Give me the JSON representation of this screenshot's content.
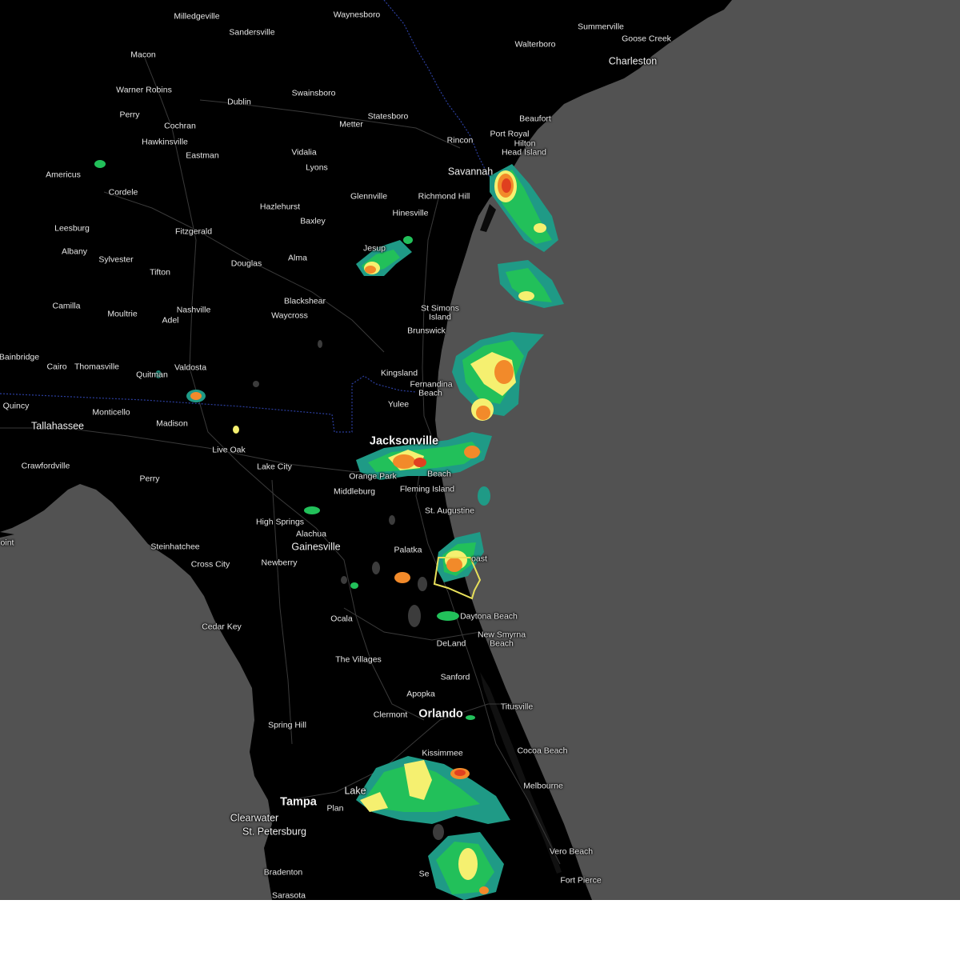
{
  "map": {
    "background_color": "#525252",
    "land_color": "#000000",
    "alert_polygon_color": "#e8e05a",
    "radar_colors": [
      "#1f9a86",
      "#22c05a",
      "#f5f070",
      "#f28a2a",
      "#e0401f"
    ]
  },
  "cities": [
    {
      "name": "Milledgeville",
      "tier": "minor"
    },
    {
      "name": "Waynesboro",
      "tier": "minor"
    },
    {
      "name": "Sandersville",
      "tier": "minor"
    },
    {
      "name": "Summerville",
      "tier": "minor"
    },
    {
      "name": "Goose Creek",
      "tier": "minor"
    },
    {
      "name": "Macon",
      "tier": "minor"
    },
    {
      "name": "Walterboro",
      "tier": "minor"
    },
    {
      "name": "Charleston",
      "tier": "mid"
    },
    {
      "name": "Warner Robins",
      "tier": "minor"
    },
    {
      "name": "Swainsboro",
      "tier": "minor"
    },
    {
      "name": "Dublin",
      "tier": "minor"
    },
    {
      "name": "Perry",
      "tier": "minor"
    },
    {
      "name": "Statesboro",
      "tier": "minor"
    },
    {
      "name": "Beaufort",
      "tier": "minor"
    },
    {
      "name": "Cochran",
      "tier": "minor"
    },
    {
      "name": "Metter",
      "tier": "minor"
    },
    {
      "name": "Port Royal",
      "tier": "minor"
    },
    {
      "name": "Hawkinsville",
      "tier": "minor"
    },
    {
      "name": "Hilton",
      "tier": "minor"
    },
    {
      "name": "Rincon",
      "tier": "minor"
    },
    {
      "name": "Head Island",
      "tier": "minor"
    },
    {
      "name": "Vidalia",
      "tier": "minor"
    },
    {
      "name": "Eastman",
      "tier": "minor"
    },
    {
      "name": "Lyons",
      "tier": "minor"
    },
    {
      "name": "Savannah",
      "tier": "mid"
    },
    {
      "name": "Americus",
      "tier": "minor"
    },
    {
      "name": "Cordele",
      "tier": "minor"
    },
    {
      "name": "Glennville",
      "tier": "minor"
    },
    {
      "name": "Richmond Hill",
      "tier": "minor"
    },
    {
      "name": "Hazlehurst",
      "tier": "minor"
    },
    {
      "name": "Hinesville",
      "tier": "minor"
    },
    {
      "name": "Baxley",
      "tier": "minor"
    },
    {
      "name": "Leesburg",
      "tier": "minor"
    },
    {
      "name": "Fitzgerald",
      "tier": "minor"
    },
    {
      "name": "Albany",
      "tier": "minor"
    },
    {
      "name": "Jesup",
      "tier": "minor"
    },
    {
      "name": "Sylvester",
      "tier": "minor"
    },
    {
      "name": "Alma",
      "tier": "minor"
    },
    {
      "name": "Douglas",
      "tier": "minor"
    },
    {
      "name": "Tifton",
      "tier": "minor"
    },
    {
      "name": "Blackshear",
      "tier": "minor"
    },
    {
      "name": "Camilla",
      "tier": "minor"
    },
    {
      "name": "Nashville",
      "tier": "minor"
    },
    {
      "name": "St Simons",
      "tier": "minor"
    },
    {
      "name": "Moultrie",
      "tier": "minor"
    },
    {
      "name": "Island",
      "tier": "minor"
    },
    {
      "name": "Waycross",
      "tier": "minor"
    },
    {
      "name": "Adel",
      "tier": "minor"
    },
    {
      "name": "Brunswick",
      "tier": "minor"
    },
    {
      "name": "Bainbridge",
      "tier": "minor"
    },
    {
      "name": "Cairo",
      "tier": "minor"
    },
    {
      "name": "Thomasville",
      "tier": "minor"
    },
    {
      "name": "Valdosta",
      "tier": "minor"
    },
    {
      "name": "Kingsland",
      "tier": "minor"
    },
    {
      "name": "Quitman",
      "tier": "minor"
    },
    {
      "name": "Fernandina",
      "tier": "minor"
    },
    {
      "name": "Beach",
      "tier": "minor"
    },
    {
      "name": "Yulee",
      "tier": "minor"
    },
    {
      "name": "Quincy",
      "tier": "minor"
    },
    {
      "name": "Monticello",
      "tier": "minor"
    },
    {
      "name": "Madison",
      "tier": "minor"
    },
    {
      "name": "Tallahassee",
      "tier": "mid"
    },
    {
      "name": "Jacksonville",
      "tier": "major"
    },
    {
      "name": "Live Oak",
      "tier": "minor"
    },
    {
      "name": "Crawfordville",
      "tier": "minor"
    },
    {
      "name": "Lake City",
      "tier": "minor"
    },
    {
      "name": "Orange Park",
      "tier": "minor"
    },
    {
      "name": "Beach",
      "tier": "minor"
    },
    {
      "name": "Perry",
      "tier": "minor"
    },
    {
      "name": "Middleburg",
      "tier": "minor"
    },
    {
      "name": "Fleming Island",
      "tier": "minor"
    },
    {
      "name": "St. Augustine",
      "tier": "minor"
    },
    {
      "name": "High Springs",
      "tier": "minor"
    },
    {
      "name": "Alachua",
      "tier": "minor"
    },
    {
      "name": "Gainesville",
      "tier": "mid"
    },
    {
      "name": "Steinhatchee",
      "tier": "minor"
    },
    {
      "name": "Palatka",
      "tier": "minor"
    },
    {
      "name": "Cross City",
      "tier": "minor"
    },
    {
      "name": "Newberry",
      "tier": "minor"
    },
    {
      "name": "oast",
      "tier": "minor"
    },
    {
      "name": "oint",
      "tier": "minor"
    },
    {
      "name": "Ocala",
      "tier": "minor"
    },
    {
      "name": "Daytona Beach",
      "tier": "minor"
    },
    {
      "name": "Cedar Key",
      "tier": "minor"
    },
    {
      "name": "New Smyrna",
      "tier": "minor"
    },
    {
      "name": "Beach",
      "tier": "minor"
    },
    {
      "name": "DeLand",
      "tier": "minor"
    },
    {
      "name": "The Villages",
      "tier": "minor"
    },
    {
      "name": "Sanford",
      "tier": "minor"
    },
    {
      "name": "Apopka",
      "tier": "minor"
    },
    {
      "name": "Titusville",
      "tier": "minor"
    },
    {
      "name": "Clermont",
      "tier": "minor"
    },
    {
      "name": "Orlando",
      "tier": "major"
    },
    {
      "name": "Spring Hill",
      "tier": "minor"
    },
    {
      "name": "Kissimmee",
      "tier": "minor"
    },
    {
      "name": "Cocoa Beach",
      "tier": "minor"
    },
    {
      "name": "Melbourne",
      "tier": "minor"
    },
    {
      "name": "Lake",
      "tier": "mid"
    },
    {
      "name": "Plan",
      "tier": "minor"
    },
    {
      "name": "Tampa",
      "tier": "major"
    },
    {
      "name": "Clearwater",
      "tier": "mid"
    },
    {
      "name": "St. Petersburg",
      "tier": "mid"
    },
    {
      "name": "Vero Beach",
      "tier": "minor"
    },
    {
      "name": "Bradenton",
      "tier": "minor"
    },
    {
      "name": "Se",
      "tier": "minor"
    },
    {
      "name": "Fort Pierce",
      "tier": "minor"
    },
    {
      "name": "Sarasota",
      "tier": "minor"
    }
  ]
}
